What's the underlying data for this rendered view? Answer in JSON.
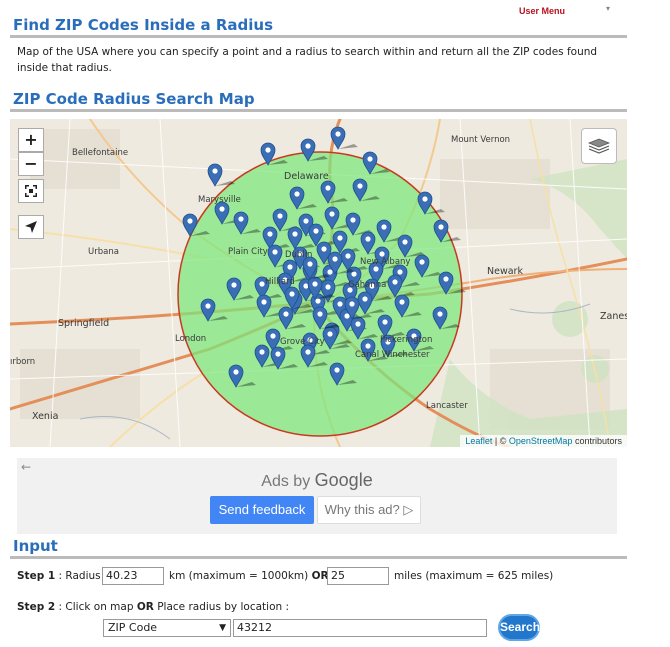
{
  "header": {
    "title": "Find ZIP Codes Inside a Radius",
    "user_menu": "User Menu"
  },
  "description": "Map of the USA where you can specify a point and a radius to search within and return all the ZIP codes found inside that radius.",
  "map_section": {
    "title": "ZIP Code Radius Search Map",
    "controls": {
      "zoom_in": "+",
      "zoom_out": "−"
    },
    "labels": {
      "bellefontaine": "Bellefontaine",
      "mount_vernon": "Mount Vernon",
      "marysville": "Marysville",
      "delaware": "Delaware",
      "urbana": "Urbana",
      "plain_city": "Plain City",
      "dublin": "Dublin",
      "hilliard": "Hilliard",
      "new_albany": "New Albany",
      "newark": "Newark",
      "gahanna": "Gahanna",
      "springfield": "Springfield",
      "london": "London",
      "grove_city": "Grove City",
      "pickerington": "Pickerington",
      "canal_winchester": "Canal Winchester",
      "zanesville": "Zanes",
      "lancaster": "Lancaster",
      "xenia": "Xenia",
      "tipp": "ırborn"
    },
    "attribution": {
      "leaflet": "Leaflet",
      "separator": "| ©",
      "osm": "OpenStreetMap",
      "contributors": "contributors"
    },
    "circle": {
      "fill": "#7ce87c",
      "stroke": "#c83a1e"
    },
    "marker_color": "#3a6fb6"
  },
  "ad": {
    "back": "←",
    "ads_by": "Ads by",
    "google": "Google",
    "send_feedback": "Send feedback",
    "why_this_ad": "Why this ad? ▷"
  },
  "input_section": {
    "title": "Input",
    "step1": {
      "label": "Step 1",
      "radius_label": ": Radius",
      "km_value": "40.23",
      "km_note": "km (maximum = 1000km)",
      "or": "OR",
      "miles_value": "25",
      "miles_note": "miles (maximum = 625 miles)"
    },
    "step2": {
      "label": "Step 2",
      "text1": ": Click on map",
      "or": "OR",
      "text2": "Place radius by location :"
    },
    "location_type": "ZIP Code",
    "location_value": "43212",
    "search_button": "Search"
  }
}
